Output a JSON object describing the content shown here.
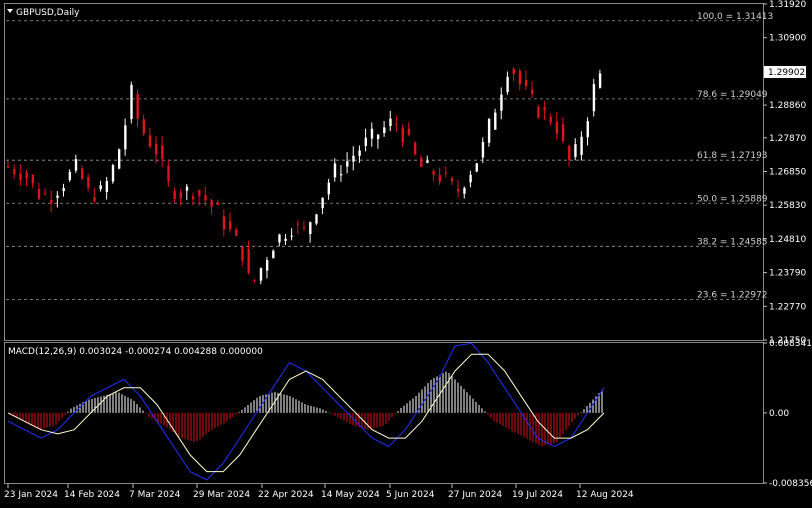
{
  "window": {
    "symbol_label": "GBPUSD,Daily",
    "macd_label": "MACD(12,26,9) 0.003024 -0.000274 0.004288 0.000000"
  },
  "colors": {
    "background": "#000000",
    "bull": "#ffffff",
    "bear": "#e0121b",
    "grid": "#9a9a9a",
    "macd_line": "#1f2fff",
    "signal_line": "#ffffcc"
  },
  "price_axis": {
    "ticks": [
      "1.31920",
      "1.30900",
      "1.29902",
      "1.28860",
      "1.27870",
      "1.26850",
      "1.25830",
      "1.24810",
      "1.23790",
      "1.22770",
      "1.21750"
    ],
    "current_price": "1.29902"
  },
  "macd_axis": {
    "ticks": [
      "0.008341",
      "0.00",
      "-0.008356"
    ]
  },
  "date_axis": {
    "ticks": [
      "23 Jan 2024",
      "14 Feb 2024",
      "7 Mar 2024",
      "29 Mar 2024",
      "22 Apr 2024",
      "14 May 2024",
      "5 Jun 2024",
      "27 Jun 2024",
      "19 Jul 2024",
      "12 Aug 2024"
    ]
  },
  "chart_data": {
    "type": "candlestick",
    "title": "GBPUSD,Daily",
    "ylim": [
      1.2175,
      1.3192
    ],
    "fibonacci": [
      {
        "label": "100.0 = 1.31413",
        "value": 1.31413
      },
      {
        "label": "78.6 = 1.29049",
        "value": 1.29049
      },
      {
        "label": "61.8 = 1.27193",
        "value": 1.27193
      },
      {
        "label": "50.0 = 1.25889",
        "value": 1.25889
      },
      {
        "label": "38.2 = 1.24585",
        "value": 1.24585
      },
      {
        "label": "23.6 = 1.22972",
        "value": 1.22972
      }
    ],
    "close_path": [
      [
        0,
        1.27
      ],
      [
        8,
        1.268
      ],
      [
        14,
        1.262
      ],
      [
        20,
        1.261
      ],
      [
        28,
        1.266
      ],
      [
        34,
        1.27
      ],
      [
        38,
        1.262
      ],
      [
        46,
        1.262
      ],
      [
        52,
        1.271
      ],
      [
        56,
        1.28
      ],
      [
        60,
        1.292
      ],
      [
        64,
        1.282
      ],
      [
        72,
        1.275
      ],
      [
        78,
        1.264
      ],
      [
        84,
        1.262
      ],
      [
        90,
        1.263
      ],
      [
        96,
        1.26
      ],
      [
        102,
        1.256
      ],
      [
        108,
        1.25
      ],
      [
        114,
        1.244
      ],
      [
        118,
        1.233
      ],
      [
        122,
        1.238
      ],
      [
        128,
        1.246
      ],
      [
        134,
        1.25
      ],
      [
        138,
        1.252
      ],
      [
        144,
        1.25
      ],
      [
        150,
        1.258
      ],
      [
        158,
        1.268
      ],
      [
        164,
        1.271
      ],
      [
        172,
        1.276
      ],
      [
        180,
        1.28
      ],
      [
        188,
        1.284
      ],
      [
        194,
        1.278
      ],
      [
        200,
        1.27
      ],
      [
        208,
        1.268
      ],
      [
        214,
        1.265
      ],
      [
        218,
        1.262
      ],
      [
        224,
        1.268
      ],
      [
        230,
        1.274
      ],
      [
        236,
        1.286
      ],
      [
        240,
        1.294
      ],
      [
        244,
        1.302
      ],
      [
        248,
        1.296
      ],
      [
        254,
        1.29
      ],
      [
        260,
        1.286
      ],
      [
        266,
        1.284
      ],
      [
        270,
        1.276
      ],
      [
        274,
        1.27
      ],
      [
        278,
        1.278
      ],
      [
        282,
        1.286
      ],
      [
        286,
        1.296
      ],
      [
        290,
        1.299
      ]
    ],
    "macd": {
      "histogram": [
        0,
        -0.001,
        -0.002,
        -0.0015,
        0.0005,
        0.0015,
        0.002,
        0.0025,
        0.0015,
        -0.0005,
        -0.0015,
        -0.003,
        -0.0035,
        -0.002,
        -0.001,
        0.0005,
        0.002,
        0.0025,
        0.002,
        0.001,
        0.0005,
        -0.0005,
        -0.0015,
        -0.002,
        -0.0015,
        0.0005,
        0.002,
        0.004,
        0.005,
        0.003,
        0.001,
        -0.001,
        -0.002,
        -0.003,
        -0.004,
        -0.0035,
        -0.001,
        0.001,
        0.003
      ],
      "macd_path": [
        -0.001,
        -0.002,
        -0.003,
        -0.002,
        0.0,
        0.002,
        0.003,
        0.004,
        0.002,
        -0.001,
        -0.004,
        -0.007,
        -0.008,
        -0.006,
        -0.003,
        0.0,
        0.003,
        0.006,
        0.005,
        0.003,
        0.001,
        -0.001,
        -0.003,
        -0.004,
        -0.002,
        0.001,
        0.004,
        0.008,
        0.0083,
        0.006,
        0.003,
        0.0,
        -0.003,
        -0.004,
        -0.003,
        0.0,
        0.003
      ],
      "signal_path": [
        0.0,
        -0.001,
        -0.002,
        -0.0025,
        -0.002,
        0.0,
        0.002,
        0.003,
        0.003,
        0.001,
        -0.002,
        -0.005,
        -0.007,
        -0.007,
        -0.005,
        -0.002,
        0.001,
        0.004,
        0.005,
        0.004,
        0.002,
        0.0,
        -0.002,
        -0.003,
        -0.003,
        -0.001,
        0.002,
        0.005,
        0.007,
        0.007,
        0.005,
        0.002,
        -0.001,
        -0.003,
        -0.003,
        -0.002,
        0.0
      ]
    }
  }
}
